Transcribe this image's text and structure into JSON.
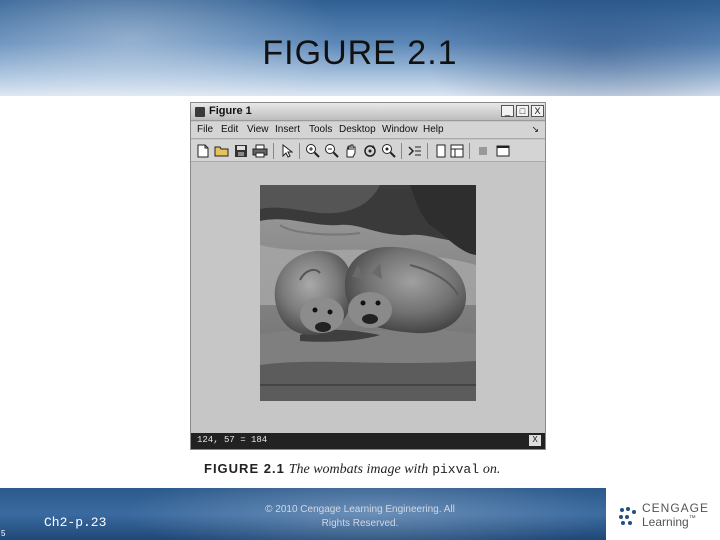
{
  "slide": {
    "title": "FIGURE 2.1",
    "slide_number": "5",
    "chapter_ref": "Ch2-p.23",
    "copyright_line1": "© 2010 Cengage Learning Engineering. All",
    "copyright_line2": "Rights Reserved."
  },
  "figure_window": {
    "title": "Figure 1",
    "menu": [
      "File",
      "Edit",
      "View",
      "Insert",
      "Tools",
      "Desktop",
      "Window",
      "Help"
    ],
    "menu_overflow_icon": "arrow-icon",
    "window_controls": [
      "minimize-icon",
      "maximize-icon",
      "close-icon"
    ],
    "window_control_glyphs": [
      "_",
      "□",
      "X"
    ],
    "toolbar_icons": [
      "new-figure-icon",
      "open-file-icon",
      "save-icon",
      "print-icon",
      "edit-plot-icon",
      "zoom-in-icon",
      "zoom-out-icon",
      "pan-icon",
      "rotate-3d-icon",
      "data-cursor-icon",
      "colorbar-icon",
      "legend-icon",
      "hide-plot-tools-icon",
      "show-plot-tools-icon"
    ],
    "image_description": "grayscale photo of two wombats",
    "status_text": "124, 57 = 184",
    "status_close": "X"
  },
  "caption": {
    "label": "FIGURE 2.1",
    "text": "The wombats image with",
    "code": "pixval",
    "suffix": "on."
  },
  "logo": {
    "brand": "CENGAGE",
    "sub": "Learning",
    "trademark": "™"
  },
  "colors": {
    "title_gradient_top": "#2f5f93",
    "footer_blue": "#2c5a8c",
    "status_bar": "#222222",
    "figure_bg": "#c6c6c6"
  }
}
